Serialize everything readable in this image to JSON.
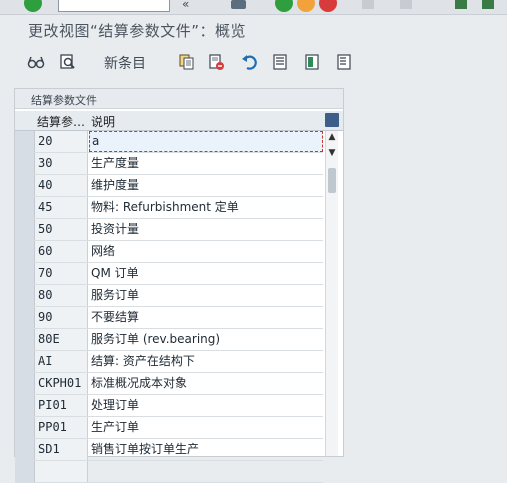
{
  "window": {
    "title": "更改视图“结算参数文件”：概览"
  },
  "toolbar": {
    "new_entries_label": "新条目",
    "icons": [
      "glasses-icon",
      "find-icon",
      "copy-icon",
      "delete-icon",
      "undo-icon",
      "select-all-icon",
      "select-block-icon",
      "deselect-all-icon"
    ]
  },
  "panel": {
    "title": "结算参数文件",
    "columns": {
      "key": "结算参…",
      "desc": "说明"
    },
    "rows": [
      {
        "key": "20",
        "desc": "a"
      },
      {
        "key": "30",
        "desc": "生产度量"
      },
      {
        "key": "40",
        "desc": "维护度量"
      },
      {
        "key": "45",
        "desc": "物料: Refurbishment 定单"
      },
      {
        "key": "50",
        "desc": "投资计量"
      },
      {
        "key": "60",
        "desc": "网络"
      },
      {
        "key": "70",
        "desc": "QM 订单"
      },
      {
        "key": "80",
        "desc": "服务订单"
      },
      {
        "key": "90",
        "desc": "不要结算"
      },
      {
        "key": "80E",
        "desc": "服务订单 (rev.bearing)"
      },
      {
        "key": "AI",
        "desc": "结算: 资产在结构下"
      },
      {
        "key": "CKPH01",
        "desc": "标准概况成本对象"
      },
      {
        "key": "PI01",
        "desc": "处理订单"
      },
      {
        "key": "PP01",
        "desc": "生产订单"
      },
      {
        "key": "SD1",
        "desc": "销售订单按订单生产"
      },
      {
        "key": "",
        "desc": ""
      }
    ]
  },
  "colors": {
    "accent_green": "#2e9e3e",
    "accent_orange": "#f2a23a",
    "accent_red": "#d83b3b",
    "selection_border": "#c0392b"
  }
}
